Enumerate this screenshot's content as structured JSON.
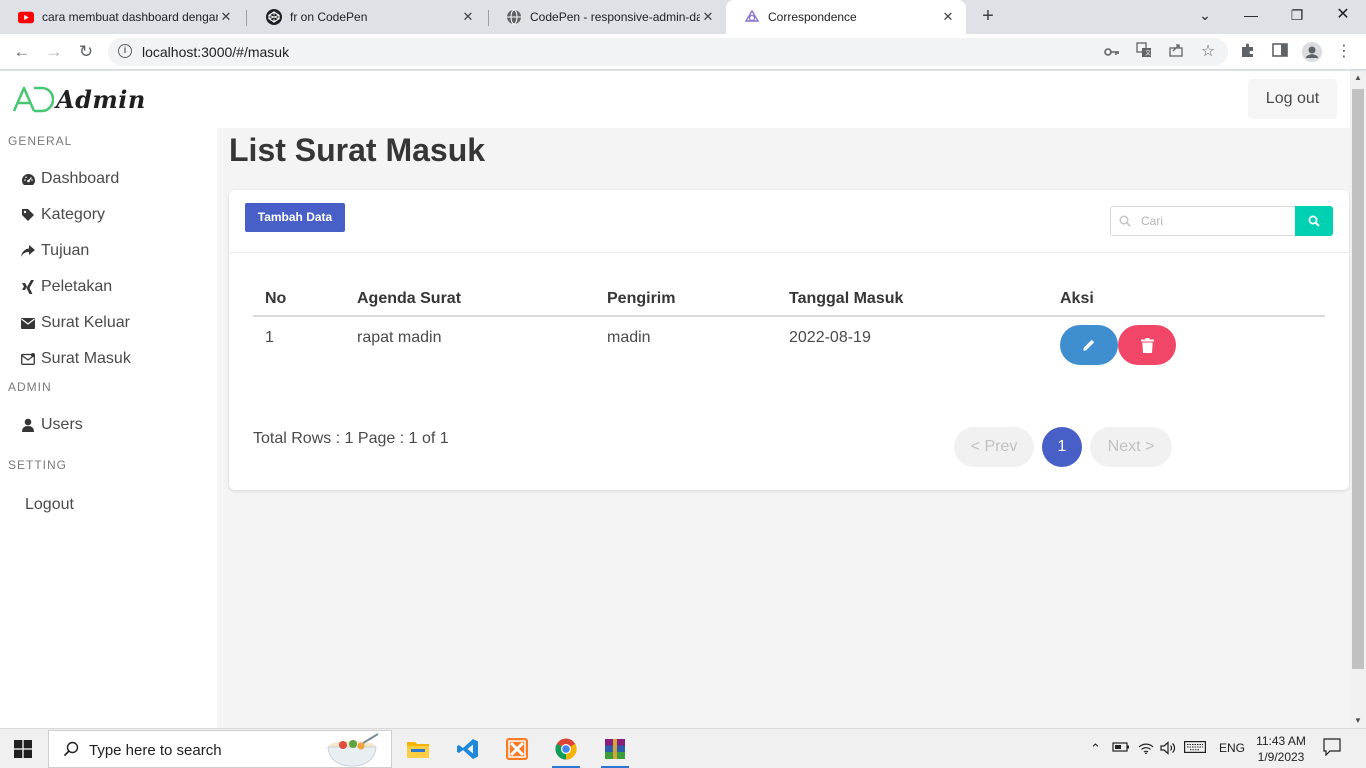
{
  "browser": {
    "tabs": [
      {
        "title": "cara membuat dashboard dengan",
        "favicon": "youtube-icon",
        "active": false
      },
      {
        "title": "fr on CodePen",
        "favicon": "codepen-icon",
        "active": false
      },
      {
        "title": "CodePen - responsive-admin-das",
        "favicon": "globe-icon",
        "active": false
      },
      {
        "title": "Correspondence",
        "favicon": "app-icon",
        "active": true
      }
    ],
    "url": "localhost:3000/#/masuk"
  },
  "app": {
    "logo_text": "Admin",
    "logout_top": "Log out",
    "accent_color": "#485fc7",
    "sidebar": {
      "general_label": "GENERAL",
      "general_items": [
        {
          "label": "Dashboard",
          "icon": "dashboard-icon"
        },
        {
          "label": "Kategory",
          "icon": "tag-icon"
        },
        {
          "label": "Tujuan",
          "icon": "share-icon"
        },
        {
          "label": "Peletakan",
          "icon": "xing-icon"
        },
        {
          "label": "Surat Keluar",
          "icon": "envelope-icon"
        },
        {
          "label": "Surat Masuk",
          "icon": "envelope-open-icon"
        }
      ],
      "admin_label": "ADMIN",
      "admin_items": [
        {
          "label": "Users",
          "icon": "user-icon"
        }
      ],
      "setting_label": "SETTING",
      "setting_items": [
        {
          "label": "Logout"
        }
      ]
    },
    "page_title": "List Surat Masuk",
    "toolbar": {
      "add_label": "Tambah Data",
      "search_placeholder": "Cari"
    },
    "table": {
      "headers": [
        "No",
        "Agenda Surat",
        "Pengirim",
        "Tanggal Masuk",
        "Aksi"
      ],
      "rows": [
        {
          "no": "1",
          "agenda": "rapat madin",
          "pengirim": "madin",
          "tanggal": "2022-08-19"
        }
      ]
    },
    "pagination": {
      "info": "Total Rows : 1 Page : 1 of 1",
      "prev": "< Prev",
      "current": "1",
      "next": "Next >"
    }
  },
  "taskbar": {
    "search_placeholder": "Type here to search",
    "language": "ENG",
    "time": "11:43 AM",
    "date": "1/9/2023"
  }
}
